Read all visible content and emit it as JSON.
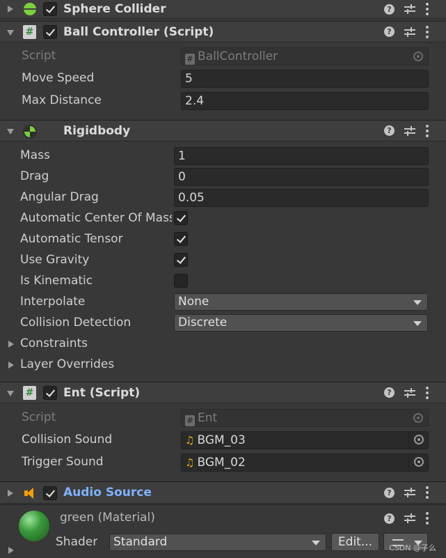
{
  "components": {
    "sphere_collider": {
      "title": "Sphere Collider"
    },
    "ball_controller": {
      "title": "Ball Controller (Script)",
      "script_label": "Script",
      "script_value": "BallController",
      "move_speed_label": "Move Speed",
      "move_speed_value": "5",
      "max_distance_label": "Max Distance",
      "max_distance_value": "2.4"
    },
    "rigidbody": {
      "title": "Rigidbody",
      "mass_label": "Mass",
      "mass_value": "1",
      "drag_label": "Drag",
      "drag_value": "0",
      "angular_drag_label": "Angular Drag",
      "angular_drag_value": "0.05",
      "auto_com_label": "Automatic Center Of Mass",
      "auto_tensor_label": "Automatic Tensor",
      "use_gravity_label": "Use Gravity",
      "is_kinematic_label": "Is Kinematic",
      "interpolate_label": "Interpolate",
      "interpolate_value": "None",
      "collision_label": "Collision Detection",
      "collision_value": "Discrete",
      "constraints_label": "Constraints",
      "layer_overrides_label": "Layer Overrides"
    },
    "ent": {
      "title": "Ent (Script)",
      "script_label": "Script",
      "script_value": "Ent",
      "collision_sound_label": "Collision Sound",
      "collision_sound_value": "BGM_03",
      "trigger_sound_label": "Trigger Sound",
      "trigger_sound_value": "BGM_02"
    },
    "audio_source": {
      "title": "Audio Source"
    },
    "material": {
      "title": "green (Material)",
      "shader_label": "Shader",
      "shader_value": "Standard",
      "edit_label": "Edit..."
    }
  },
  "icons": {
    "help": "?",
    "script": "#",
    "audio_clip": "♫"
  },
  "colors": {
    "panel_bg": "#383838",
    "header_bg": "#3e3e3e",
    "link_blue": "#7fb2ff",
    "collider_green": "#7bd13c",
    "material_green": "#3a9a3a",
    "audio_orange": "#f0a000"
  },
  "watermark": "CSDN @子么"
}
